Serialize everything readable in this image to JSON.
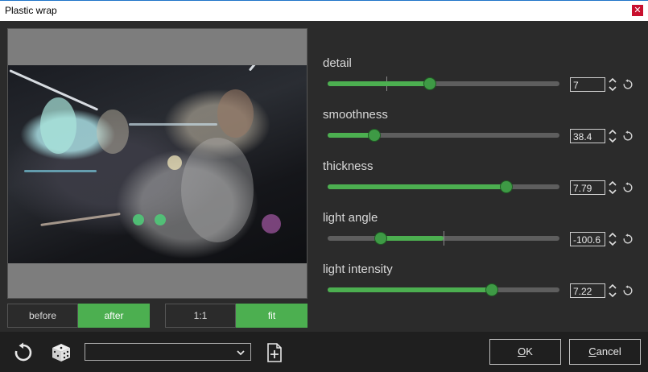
{
  "window": {
    "title": "Plastic wrap"
  },
  "view_toggles": {
    "before_label": "before",
    "after_label": "after",
    "one_to_one_label": "1:1",
    "fit_label": "fit"
  },
  "parameters": [
    {
      "label": "detail",
      "value": "7",
      "fraction": 0.44
    },
    {
      "label": "smoothness",
      "value": "38.4",
      "fraction": 0.2
    },
    {
      "label": "thickness",
      "value": "7.79",
      "fraction": 0.77
    },
    {
      "label": "light angle",
      "value": "-100.6",
      "fraction": 0.23
    },
    {
      "label": "light intensity",
      "value": "7.22",
      "fraction": 0.71
    }
  ],
  "footer": {
    "preset_value": "",
    "ok_label": "OK",
    "ok_hotkey": "O",
    "ok_rest": "K",
    "cancel_hotkey": "C",
    "cancel_rest": "ancel"
  },
  "colors": {
    "accent": "#4caf50",
    "background": "#2b2b2b",
    "footer": "#1f1f1f",
    "close": "#c8102e"
  },
  "icons": [
    "close-icon",
    "spinner-arrows-icon",
    "reset-icon",
    "dice-icon",
    "add-preset-icon",
    "chevron-down-icon"
  ]
}
